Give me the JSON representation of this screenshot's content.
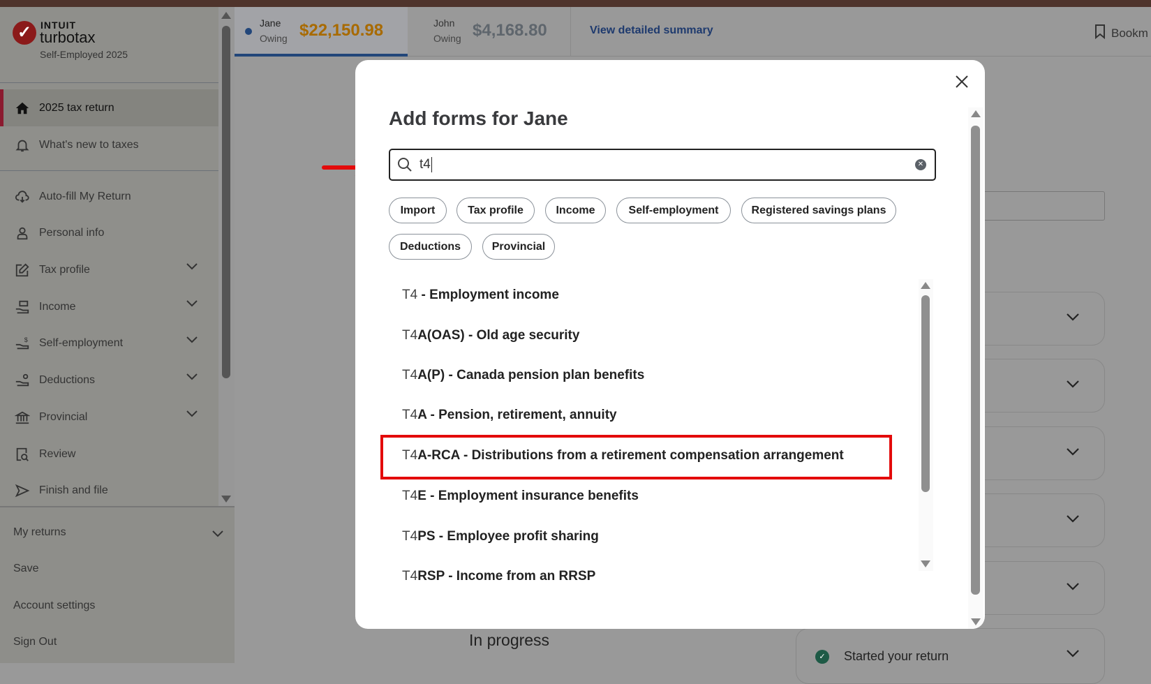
{
  "sidebar": {
    "logo": {
      "brand": "INTUIT",
      "product": "turbotax",
      "edition": "Self-Employed 2025"
    },
    "items": [
      {
        "label": "2025 tax return",
        "icon": "home-icon"
      },
      {
        "label": "What's new to taxes",
        "icon": "bell-icon"
      },
      {
        "label": "Auto-fill My Return",
        "icon": "cloud-download-icon"
      },
      {
        "label": "Personal info",
        "icon": "person-icon"
      },
      {
        "label": "Tax profile",
        "icon": "edit-icon"
      },
      {
        "label": "Income",
        "icon": "income-icon"
      },
      {
        "label": "Self-employment",
        "icon": "hand-dollar-icon"
      },
      {
        "label": "Deductions",
        "icon": "hand-person-icon"
      },
      {
        "label": "Provincial",
        "icon": "bank-icon"
      },
      {
        "label": "Review",
        "icon": "document-search-icon"
      },
      {
        "label": "Finish and file",
        "icon": "send-icon"
      }
    ],
    "bottom": [
      {
        "label": "My returns"
      },
      {
        "label": "Save"
      },
      {
        "label": "Account settings"
      },
      {
        "label": "Sign Out"
      }
    ]
  },
  "header": {
    "jane": {
      "name": "Jane",
      "status": "Owing",
      "amount": "$22,150.98"
    },
    "john": {
      "name": "John",
      "status": "Owing",
      "amount": "$4,168.80"
    },
    "summary_link": "View detailed summary",
    "bookmark": "Bookm"
  },
  "background": {
    "in_progress": "In progress",
    "started": "Started your return"
  },
  "modal": {
    "title": "Add forms for Jane",
    "search_value": "t4",
    "chips": [
      "Import",
      "Tax profile",
      "Income",
      "Self-employment",
      "Registered savings plans",
      "Deductions",
      "Provincial"
    ],
    "results": [
      {
        "prefix": "T4",
        "rest": " - Employment income"
      },
      {
        "prefix": "T4",
        "rest": "A(OAS) - Old age security"
      },
      {
        "prefix": "T4",
        "rest": "A(P) - Canada pension plan benefits"
      },
      {
        "prefix": "T4",
        "rest": "A - Pension, retirement, annuity"
      },
      {
        "prefix": "T4",
        "rest": "A-RCA - Distributions from a retirement compensation arrangement"
      },
      {
        "prefix": "T4",
        "rest": "E - Employment insurance benefits"
      },
      {
        "prefix": "T4",
        "rest": "PS - Employee profit sharing"
      },
      {
        "prefix": "T4",
        "rest": "RSP - Income from an RRSP"
      }
    ]
  },
  "colors": {
    "accent_red": "#e30b0b",
    "owing": "#a86a00",
    "link": "#1e3a6e"
  }
}
